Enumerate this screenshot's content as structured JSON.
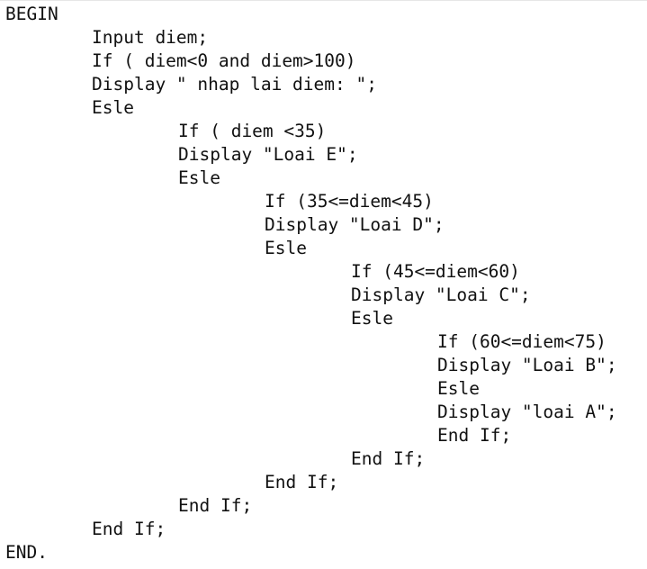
{
  "code": {
    "lines": [
      "BEGIN",
      "Input diem;",
      "If ( diem<0 and diem>100)",
      "Display \" nhap lai diem: \";",
      "Esle",
      "If ( diem <35)",
      "Display \"Loai E\";",
      "Esle",
      "If (35<=diem<45)",
      "Display \"Loai D\";",
      "Esle",
      "If (45<=diem<60)",
      "Display \"Loai C\";",
      "Esle",
      "If (60<=diem<75)",
      "Display \"Loai B\";",
      "Esle",
      "Display \"loai A\";",
      "End If;",
      "End If;",
      "End If;",
      "End If;",
      "End If;",
      "END."
    ]
  }
}
